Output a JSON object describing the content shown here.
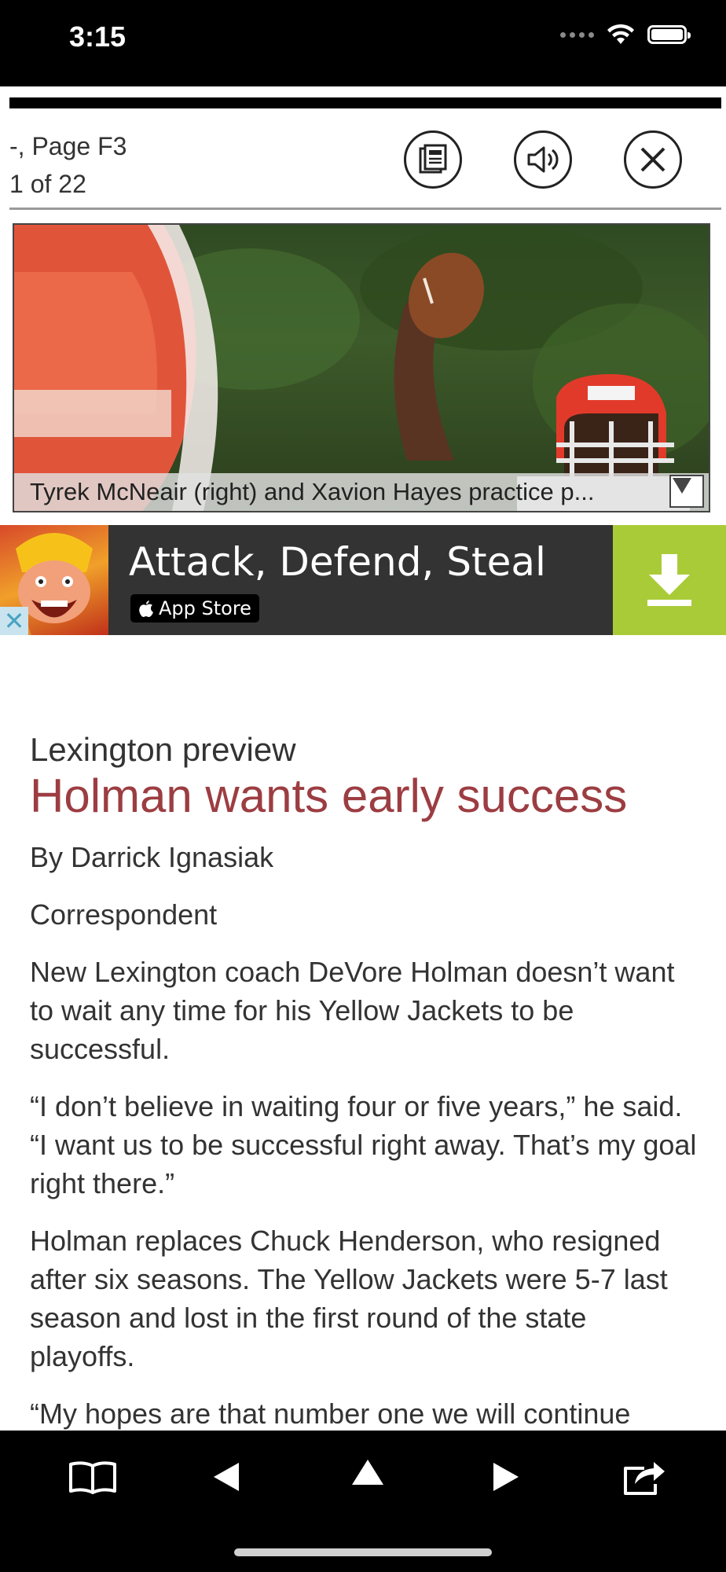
{
  "status_bar": {
    "time": "3:15"
  },
  "header": {
    "page_label": "-, Page F3",
    "page_count": "1 of 22",
    "buttons": [
      {
        "name": "page-view-icon"
      },
      {
        "name": "audio-icon"
      },
      {
        "name": "close-icon"
      }
    ]
  },
  "photo": {
    "caption": "Tyrek McNeair (right) and Xavion Hayes practice p..."
  },
  "ad": {
    "title": "Attack, Defend, Steal",
    "store_badge": "App Store",
    "accent_color": "#aacb38"
  },
  "article": {
    "kicker": "Lexington preview",
    "headline": "Holman wants early success",
    "headline_color": "#9c3d42",
    "byline": "By Darrick Ignasiak",
    "role": "Correspondent",
    "paragraphs": [
      "New Lexington coach DeVore Holman doesn’t want to wait any time for his Yellow Jackets to be successful.",
      "“I don’t believe in waiting four or five years,” he said. “I want us to be successful right away. That’s my goal right there.”",
      "Holman replaces Chuck Henderson, who resigned after six seasons. The Yellow Jackets were 5-7 last season and lost in the first round of the state playoffs.",
      "“My hopes are that number one we will continue"
    ]
  },
  "toolbar": {
    "items": [
      "book-icon",
      "previous-icon",
      "up-icon",
      "next-icon",
      "share-icon"
    ]
  }
}
